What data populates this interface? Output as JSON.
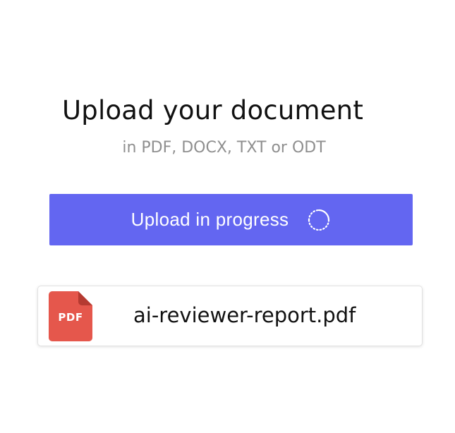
{
  "header": {
    "title": "Upload your document",
    "subtitle": "in PDF, DOCX, TXT or ODT"
  },
  "upload_button": {
    "label": "Upload in progress",
    "status_icon": "loading-spinner-icon"
  },
  "file": {
    "type_badge": "PDF",
    "icon": "pdf-file-icon",
    "name": "ai-reviewer-report.pdf"
  },
  "colors": {
    "accent": "#6366f1",
    "pdf_icon": "#e5574c"
  }
}
